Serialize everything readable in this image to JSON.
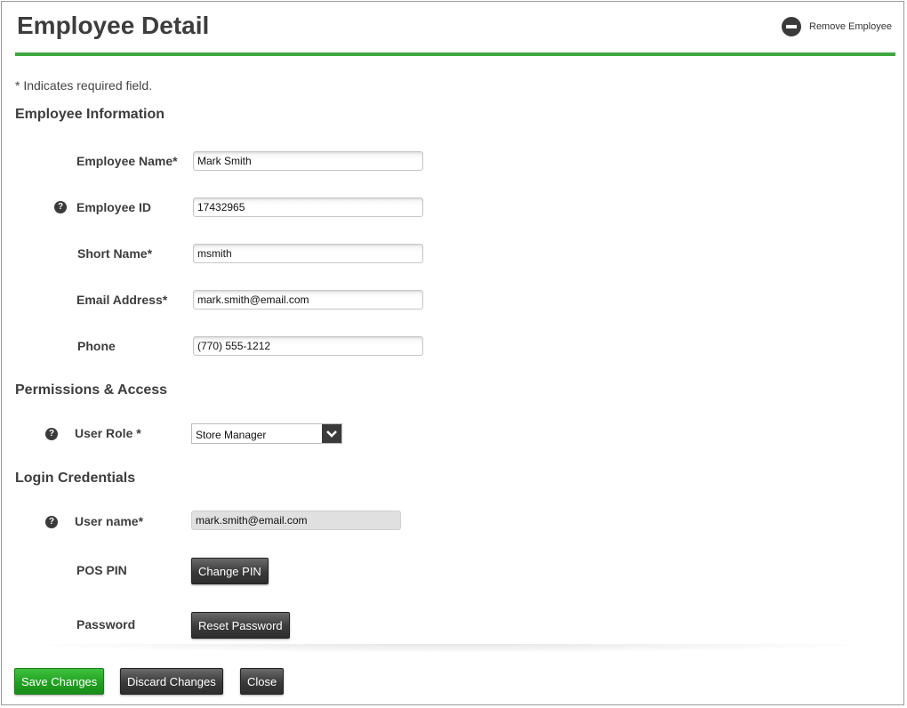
{
  "header": {
    "title": "Employee Detail",
    "remove_label": "Remove Employee",
    "accent_color": "#3fa73f"
  },
  "required_note": "* Indicates required field.",
  "sections": {
    "employee_info": "Employee Information",
    "permissions": "Permissions & Access",
    "login": "Login Credentials"
  },
  "fields": {
    "employee_name": {
      "label": "Employee Name*",
      "value": "Mark Smith"
    },
    "employee_id": {
      "label": "Employee ID",
      "value": "17432965"
    },
    "short_name": {
      "label": "Short Name*",
      "value": "msmith"
    },
    "email": {
      "label": "Email Address*",
      "value": "mark.smith@email.com"
    },
    "phone": {
      "label": "Phone",
      "value": "(770) 555-1212"
    },
    "user_role": {
      "label": "User Role *",
      "value": "Store Manager"
    },
    "username": {
      "label": "User name*",
      "value": "mark.smith@email.com"
    },
    "pos_pin": {
      "label": "POS PIN",
      "button": "Change PIN"
    },
    "password": {
      "label": "Password",
      "button": "Reset Password"
    }
  },
  "footer": {
    "save": "Save Changes",
    "discard": "Discard Changes",
    "close": "Close"
  },
  "icons": {
    "help": "?",
    "remove": "minus-circle-icon",
    "dropdown": "chevron-down-icon"
  }
}
